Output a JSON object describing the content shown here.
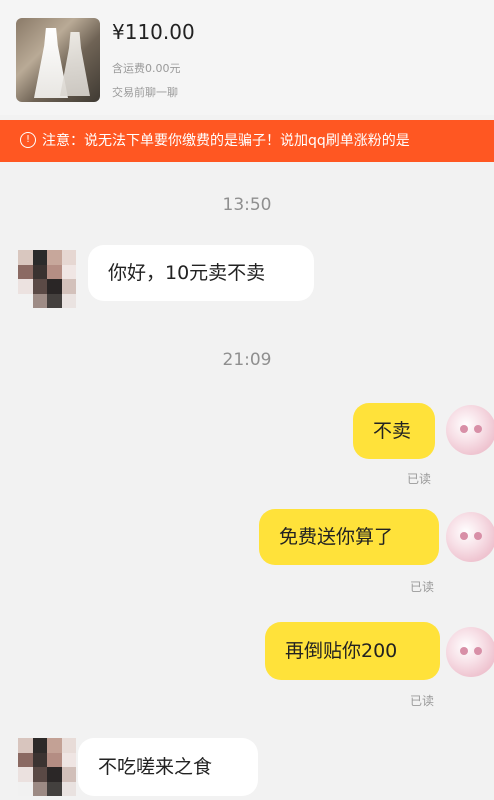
{
  "product": {
    "price": "¥110.00",
    "shipping": "含运费0.00元",
    "chat_hint": "交易前聊一聊"
  },
  "notice": {
    "icon": "info-icon",
    "text": "注意：说无法下单要你缴费的是骗子！说加qq刷单涨粉的是"
  },
  "messages": {
    "time1": "13:50",
    "msg1": "你好，10元卖不卖",
    "time2": "21:09",
    "msg2": "不卖",
    "read2": "已读",
    "msg3": "免费送你算了",
    "read3": "已读",
    "msg4": "再倒贴你200",
    "read4": "已读",
    "msg5": "不吃嗟来之食"
  },
  "colors": {
    "notice_bg": "#ff5722",
    "my_bubble": "#ffe23a",
    "their_bubble": "#ffffff"
  }
}
